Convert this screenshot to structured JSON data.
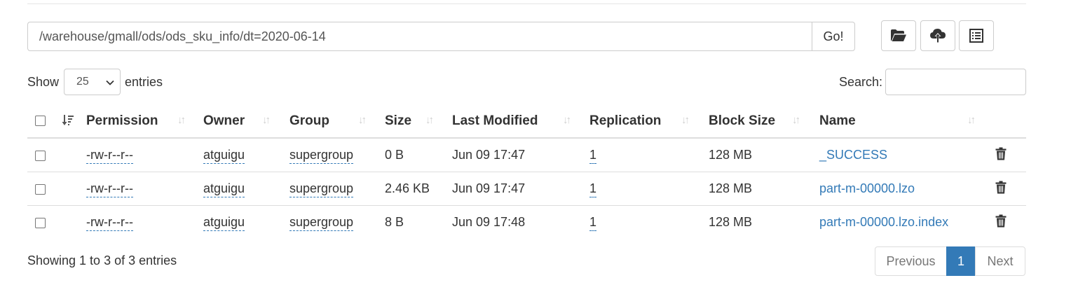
{
  "path_bar": {
    "path_value": "/warehouse/gmall/ods/ods_sku_info/dt=2020-06-14",
    "go_label": "Go!"
  },
  "toolbar_icons": [
    "folder-open-icon",
    "cloud-upload-icon",
    "list-alt-icon"
  ],
  "length_control": {
    "show_label": "Show",
    "selected": "25",
    "entries_label": "entries"
  },
  "search": {
    "label": "Search:",
    "value": ""
  },
  "table": {
    "columns": [
      "Permission",
      "Owner",
      "Group",
      "Size",
      "Last Modified",
      "Replication",
      "Block Size",
      "Name"
    ],
    "rows": [
      {
        "permission": "-rw-r--r--",
        "owner": "atguigu",
        "group": "supergroup",
        "size": "0 B",
        "last_modified": "Jun 09 17:47",
        "replication": "1",
        "block_size": "128 MB",
        "name": "_SUCCESS"
      },
      {
        "permission": "-rw-r--r--",
        "owner": "atguigu",
        "group": "supergroup",
        "size": "2.46 KB",
        "last_modified": "Jun 09 17:47",
        "replication": "1",
        "block_size": "128 MB",
        "name": "part-m-00000.lzo"
      },
      {
        "permission": "-rw-r--r--",
        "owner": "atguigu",
        "group": "supergroup",
        "size": "8 B",
        "last_modified": "Jun 09 17:48",
        "replication": "1",
        "block_size": "128 MB",
        "name": "part-m-00000.lzo.index"
      }
    ]
  },
  "footer": {
    "info": "Showing 1 to 3 of 3 entries",
    "previous_label": "Previous",
    "current_page": "1",
    "next_label": "Next"
  },
  "colors": {
    "link": "#337ab7",
    "active_page_bg": "#337ab7",
    "border": "#dddddd"
  }
}
